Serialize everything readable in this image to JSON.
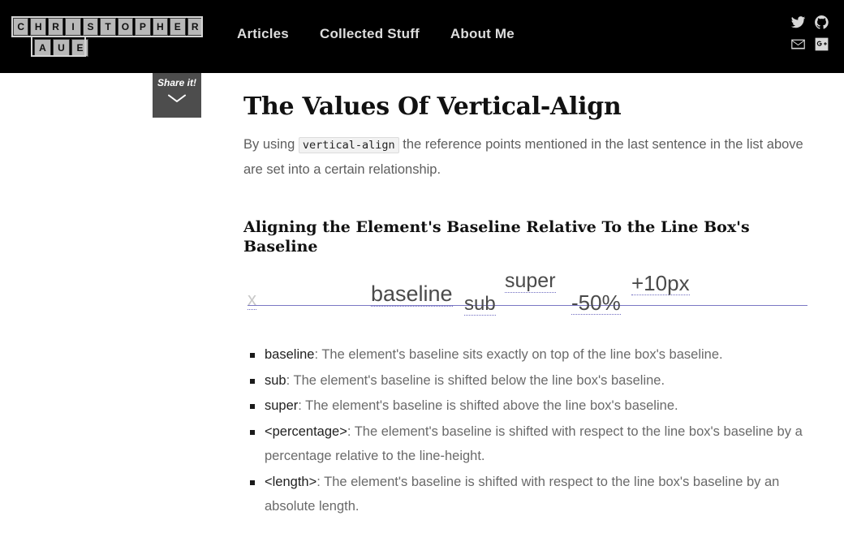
{
  "header": {
    "logo": {
      "name": "christopher-aue-logo",
      "row1": [
        "C",
        "H",
        "R",
        "I",
        "S",
        "T",
        "O",
        "P",
        "H",
        "E",
        "R"
      ],
      "row2": [
        "A",
        "U",
        "E"
      ],
      "text": "CHRISTOPHER AUE"
    },
    "nav": [
      {
        "label": "Articles",
        "name": "nav-articles"
      },
      {
        "label": "Collected Stuff",
        "name": "nav-collected-stuff"
      },
      {
        "label": "About Me",
        "name": "nav-about-me"
      }
    ],
    "social": [
      {
        "label": "Twitter",
        "icon": "twitter-icon"
      },
      {
        "label": "GitHub",
        "icon": "github-icon"
      },
      {
        "label": "Email",
        "icon": "envelope-icon"
      },
      {
        "label": "Google Plus",
        "icon": "google-plus-icon"
      }
    ],
    "background_color": "#000000"
  },
  "share_tab": {
    "label": "Share it!",
    "icon": "chevron-down-icon",
    "background_color": "#4d4d4d"
  },
  "article": {
    "title": "The Values Of Vertical-Align",
    "intro": {
      "before_code": "By using ",
      "code": "vertical-align",
      "after_code": " the reference points mentioned in the last sentence in the list above are set into a certain relationship."
    },
    "section_title": "Aligning the Element's Baseline Relative To the Line Box's Baseline"
  },
  "demo": {
    "baseline_color": "#7b78c4",
    "underline_color": "#6f6cc0",
    "words": [
      {
        "text": "x",
        "name": "demo-word-x",
        "align": "reference"
      },
      {
        "text": "baseline",
        "name": "demo-word-baseline",
        "align": "baseline"
      },
      {
        "text": "sub",
        "name": "demo-word-sub",
        "align": "sub"
      },
      {
        "text": "super",
        "name": "demo-word-super",
        "align": "super"
      },
      {
        "text": "-50%",
        "name": "demo-word-percentage",
        "align": "-50%"
      },
      {
        "text": "+10px",
        "name": "demo-word-length",
        "align": "+10px"
      }
    ]
  },
  "values": [
    {
      "term": "baseline",
      "separator": ":",
      "description": " The element's baseline sits exactly on top of the line box's baseline."
    },
    {
      "term": "sub",
      "separator": ":",
      "description": " The element's baseline is shifted below the line box's baseline."
    },
    {
      "term": "super",
      "separator": ":",
      "description": " The element's baseline is shifted above the line box's baseline."
    },
    {
      "term": "<percentage>",
      "separator": ":",
      "description": " The element's baseline is shifted with respect to the line box's baseline by a percentage relative to the line-height."
    },
    {
      "term": "<length>",
      "separator": ":",
      "description": " The element's baseline is shifted with respect to the line box's baseline by an absolute length."
    }
  ]
}
